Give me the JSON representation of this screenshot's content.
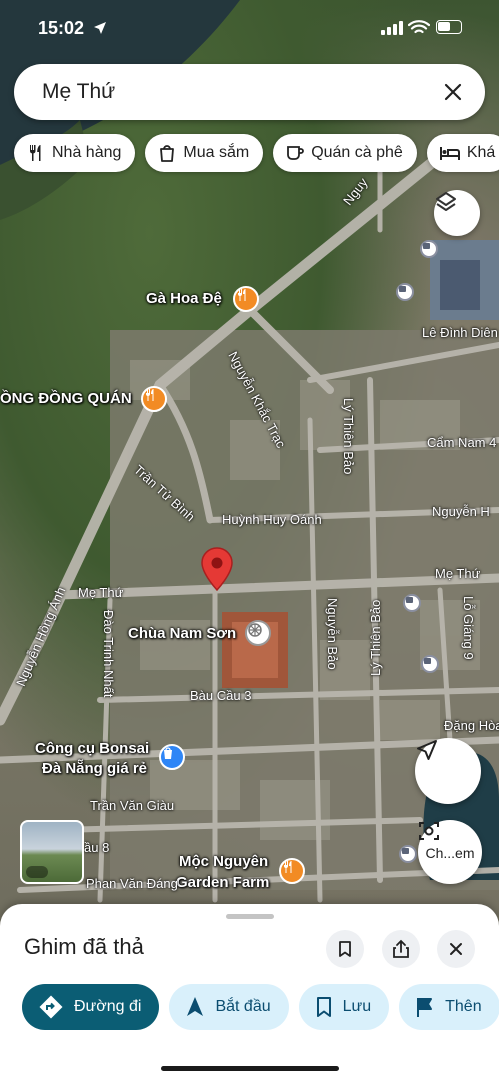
{
  "status_bar": {
    "time": "15:02"
  },
  "search": {
    "query": "Mẹ Thứ"
  },
  "chips": [
    {
      "label": "Nhà hàng",
      "icon": "fork-knife-icon"
    },
    {
      "label": "Mua sắm",
      "icon": "shopping-bag-icon"
    },
    {
      "label": "Quán cà phê",
      "icon": "coffee-cup-icon"
    },
    {
      "label": "Khá",
      "icon": "bed-icon"
    }
  ],
  "map": {
    "places": {
      "ga_hoa_de": "Gà Hoa Đệ",
      "dong_quan": "ỒNG ĐỒNG QUÁN",
      "chua_nam_son": "Chùa Nam Sơn",
      "bonsai_1": "Công cụ Bonsai",
      "bonsai_2": "Đà Nẵng giá rẻ",
      "moc_nguyen_1": "Mộc Nguyên",
      "moc_nguyen_2": "Garden Farm"
    },
    "streets": {
      "me_thu_left": "Mẹ Thứ",
      "me_thu_right": "Mẹ Thứ",
      "nguyen_khac_trac": "Nguyễn Khắc Trạc",
      "ly_thien_bao_1": "Lý Thiên Bảo",
      "ly_thien_bao_2": "Lý Thiên Bảo",
      "le_dinh_dien": "Lê Đình Diên",
      "cam_nam": "Cẩm Nam 4",
      "tran_tu_binh": "Trần Tử Bình",
      "huy_oanh": "Huỳnh Huy Oánh",
      "nguyen_h": "Nguyễn H",
      "nguyen_hong_anh": "Nguyễn Hồng Ánh",
      "dao_trinh_nhat": "Đào Trinh Nhất",
      "nguyen_bao": "Nguyễn Bảo",
      "lo_giang": "Lỗ Giáng 9",
      "bau_cau": "Bàu Cầu 3",
      "dang_hoa": "Đặng Hòa",
      "tran_van_giau": "Trần Văn Giàu",
      "au_8": "ầu 8",
      "phan_van_dang": "Phan Văn Đáng",
      "nguyen_top": "Nguy"
    },
    "streetview_label": "Ch...em"
  },
  "sheet": {
    "title": "Ghim đã thả",
    "actions": [
      {
        "label": "Đường đi",
        "icon": "directions-icon"
      },
      {
        "label": "Bắt đầu",
        "icon": "navigation-arrow-icon"
      },
      {
        "label": "Lưu",
        "icon": "bookmark-icon"
      },
      {
        "label": "Thên",
        "icon": "flag-icon"
      }
    ]
  },
  "colors": {
    "restaurant_poi": "#f28b24",
    "shop_poi": "#2f86f6",
    "pin": "#e53935",
    "primary_action": "#0b5d74",
    "secondary_action": "#d9f0fb"
  }
}
